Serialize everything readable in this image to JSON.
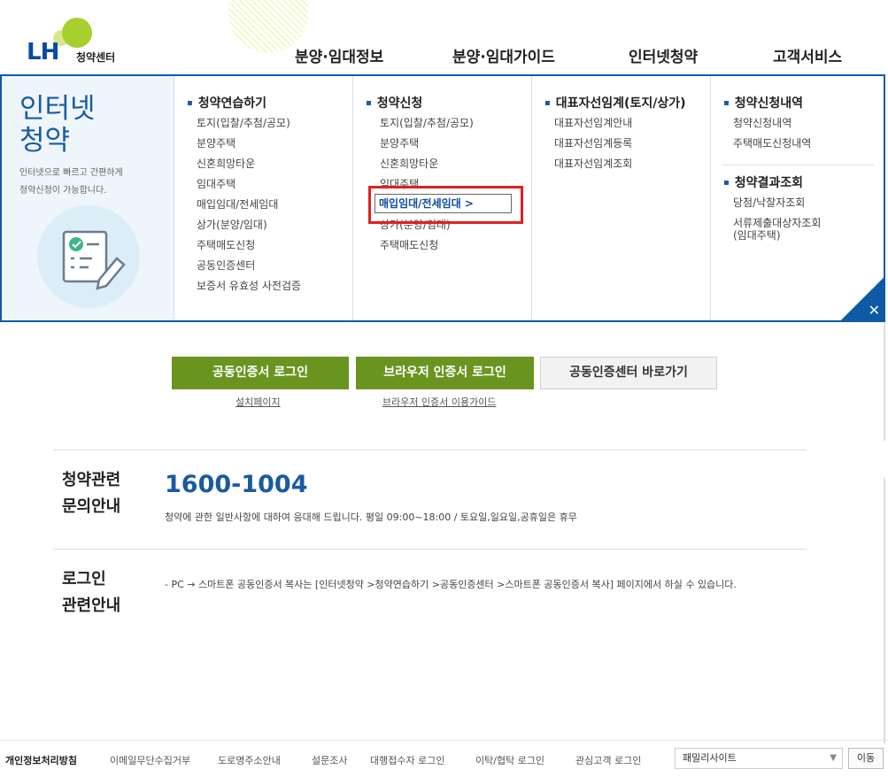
{
  "header": {
    "logo_text": "LH",
    "logo_sub": "청약센터",
    "nav": [
      "분양·임대정보",
      "분양·임대가이드",
      "인터넷청약",
      "고객서비스"
    ]
  },
  "mega": {
    "intro_title_1": "인터넷",
    "intro_title_2": "청약",
    "intro_desc_1": "인터넷으로 빠르고 간편하게",
    "intro_desc_2": "청약신청이 가능합니다.",
    "col1": {
      "title": "청약연습하기",
      "items": [
        "토지(입찰/추첨/공모)",
        "분양주택",
        "신혼희망타운",
        "임대주택",
        "매입임대/전세임대",
        "상가(분양/임대)",
        "주택매도신청",
        "공동인증센터",
        "보증서 유효성 사전검증"
      ]
    },
    "col2": {
      "title": "청약신청",
      "items": [
        "토지(입찰/추첨/공모)",
        "분양주택",
        "신혼희망타운",
        "임대주택",
        "매입임대/전세임대 >",
        "상가(분양/임대)",
        "주택매도신청"
      ]
    },
    "col3": {
      "title": "대표자선임계(토지/상가)",
      "items": [
        "대표자선임계안내",
        "대표자선임계등록",
        "대표자선임계조회"
      ]
    },
    "col4": {
      "title": "청약신청내역",
      "items": [
        "청약신청내역",
        "주택매도신청내역"
      ],
      "title2": "청약결과조회",
      "items2": [
        "당첨/낙찰자조회",
        "서류제출대상자조회",
        "(임대주택)"
      ]
    },
    "close": "✕"
  },
  "login": {
    "btn1": "공동인증서 로그인",
    "btn2": "브라우저 인증서 로그인",
    "btn3": "공동인증센터 바로가기",
    "link1": "설치페이지",
    "link2": "브라우저 인증서 이용가이드"
  },
  "inquiry": {
    "title1": "청약관련",
    "title2": "문의안내",
    "phone": "1600-1004",
    "desc": "청약에 관한 일반사항에 대하여 응대해 드립니다. 평일 09:00~18:00  /  토요일,일요일,공휴일은 휴무"
  },
  "login_info": {
    "title1": "로그인",
    "title2": "관련안내",
    "desc": "- PC →  스마트폰 공동인증서 복사는 [인터넷청약 >청약연습하기 >공동인증센터 >스마트폰 공동인증서 복사] 페이지에서 하실 수 있습니다."
  },
  "footer": {
    "links": [
      "개인정보처리방침",
      "이메일무단수집거부",
      "도로명주소안내",
      "설문조사",
      "대행접수자 로그인",
      "이탁/협탁 로그인",
      "관심고객 로그인"
    ],
    "family_site": "패밀리사이트",
    "go": "이동"
  }
}
